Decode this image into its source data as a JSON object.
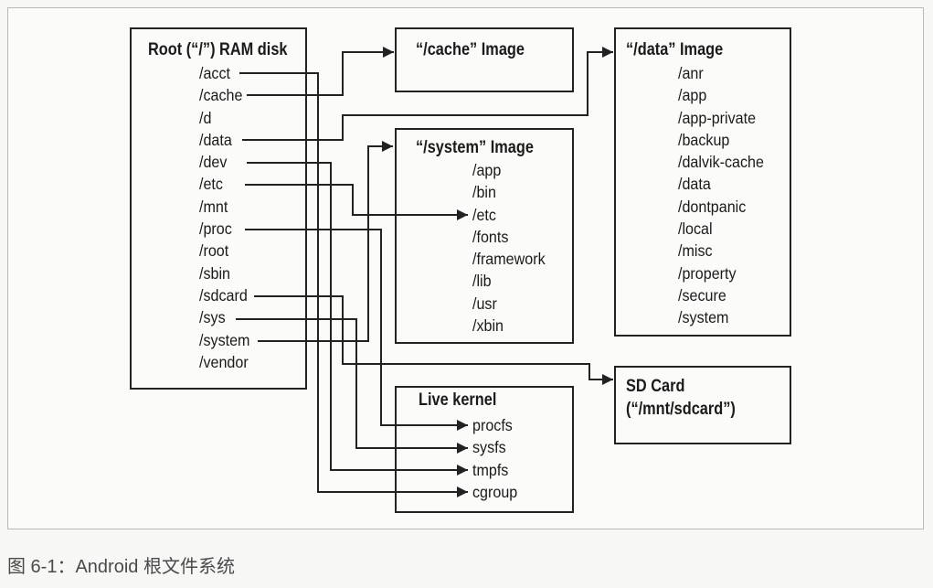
{
  "caption": "图 6-1：Android 根文件系统",
  "root": {
    "title": "Root (“/”) RAM disk",
    "items": [
      "/acct",
      "/cache",
      "/d",
      "/data",
      "/dev",
      "/etc",
      "/mnt",
      "/proc",
      "/root",
      "/sbin",
      "/sdcard",
      "/sys",
      "/system",
      "/vendor"
    ]
  },
  "cache": {
    "title": "“/cache” Image"
  },
  "data": {
    "title": "“/data” Image",
    "items": [
      "/anr",
      "/app",
      "/app-private",
      "/backup",
      "/dalvik-cache",
      "/data",
      "/dontpanic",
      "/local",
      "/misc",
      "/property",
      "/secure",
      "/system"
    ]
  },
  "system": {
    "title": "“/system” Image",
    "items": [
      "/app",
      "/bin",
      "/etc",
      "/fonts",
      "/framework",
      "/lib",
      "/usr",
      "/xbin"
    ]
  },
  "sdcard": {
    "line1": "SD Card",
    "line2": "(“/mnt/sdcard”)"
  },
  "kernel": {
    "title": "Live kernel",
    "items": [
      "procfs",
      "sysfs",
      "tmpfs",
      "cgroup"
    ]
  },
  "colors": {
    "line": "#222222",
    "frame": "#b9b9b9"
  }
}
